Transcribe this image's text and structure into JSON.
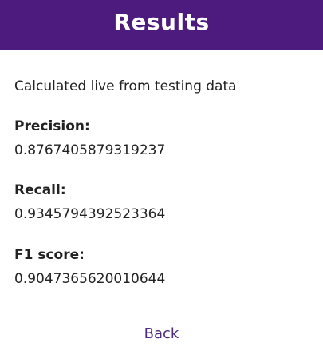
{
  "header": {
    "title": "Results",
    "background_color": "#4d1a7e",
    "text_color": "#ffffff"
  },
  "main": {
    "subtitle": "Calculated live from testing data",
    "metrics": [
      {
        "label": "Precision:",
        "value": "0.8767405879319237"
      },
      {
        "label": "Recall:",
        "value": "0.9345794392523364"
      },
      {
        "label": "F1 score:",
        "value": "0.9047365620010644"
      }
    ]
  },
  "footer": {
    "back_label": "Back",
    "link_color": "#4d2a7e"
  }
}
